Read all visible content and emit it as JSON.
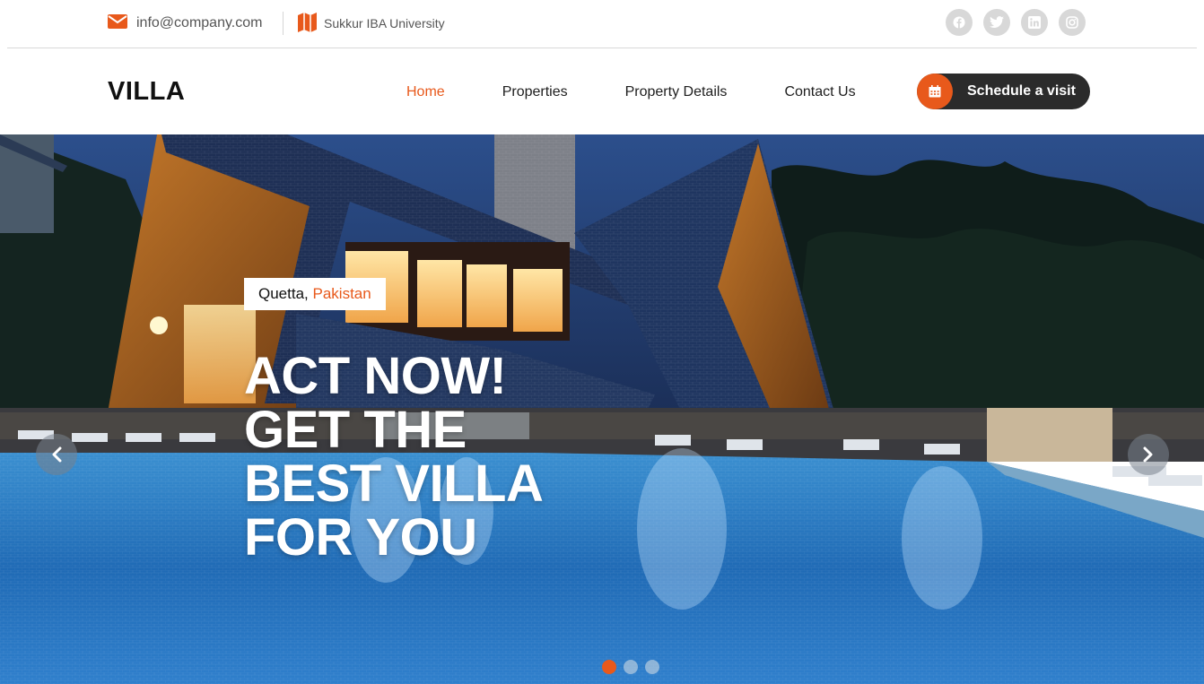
{
  "topbar": {
    "email": "info@company.com",
    "email_icon": "envelope-icon",
    "location": "Sukkur IBA University",
    "location_icon": "map-icon",
    "socials": [
      {
        "icon": "facebook-icon"
      },
      {
        "icon": "twitter-icon"
      },
      {
        "icon": "linkedin-icon"
      },
      {
        "icon": "instagram-icon"
      }
    ]
  },
  "header": {
    "logo": "VILLA",
    "nav": [
      {
        "label": "Home",
        "active": true
      },
      {
        "label": "Properties",
        "active": false
      },
      {
        "label": "Property Details",
        "active": false
      },
      {
        "label": "Contact Us",
        "active": false
      }
    ],
    "cta_label": "Schedule a visit",
    "cta_icon": "calendar-icon"
  },
  "hero": {
    "badge_city": "Quetta,",
    "badge_country": "Pakistan",
    "headline": [
      "ACT NOW!",
      "GET THE",
      "BEST VILLA",
      "FOR YOU"
    ],
    "prev_icon": "chevron-left-icon",
    "next_icon": "chevron-right-icon",
    "slides": 3,
    "active_slide": 1
  },
  "colors": {
    "accent": "#e8591b",
    "dark": "#2b2b2b",
    "text": "#1e1e1e"
  }
}
